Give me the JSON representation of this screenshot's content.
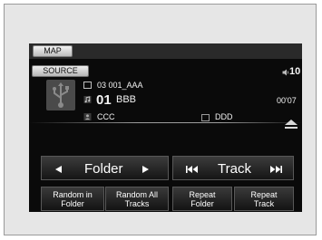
{
  "topbar": {
    "map_label": "MAP"
  },
  "header": {
    "source_label": "SOURCE",
    "volume": "10"
  },
  "track_info": {
    "folder_line": "03  001_AAA",
    "track_number": "01",
    "track_title": "BBB",
    "elapsed_time": "00'07",
    "artist": "CCC",
    "album": "DDD"
  },
  "controls": {
    "folder_label": "Folder",
    "track_label": "Track"
  },
  "modes": [
    {
      "line1": "Random in",
      "line2": "Folder"
    },
    {
      "line1": "Random All",
      "line2": "Tracks"
    },
    {
      "line1": "Repeat",
      "line2": "Folder"
    },
    {
      "line1": "Repeat",
      "line2": "Track"
    }
  ],
  "icons": {
    "usb": "usb-icon",
    "speaker": "speaker-icon",
    "folder": "folder-icon",
    "music_note": "music-note-icon",
    "artist": "artist-icon",
    "album": "album-icon",
    "eject": "eject-icon"
  },
  "colors": {
    "screen_bg": "#0a0a0a",
    "text": "#f2f2f2",
    "frame_bg": "#e6e6e6"
  }
}
